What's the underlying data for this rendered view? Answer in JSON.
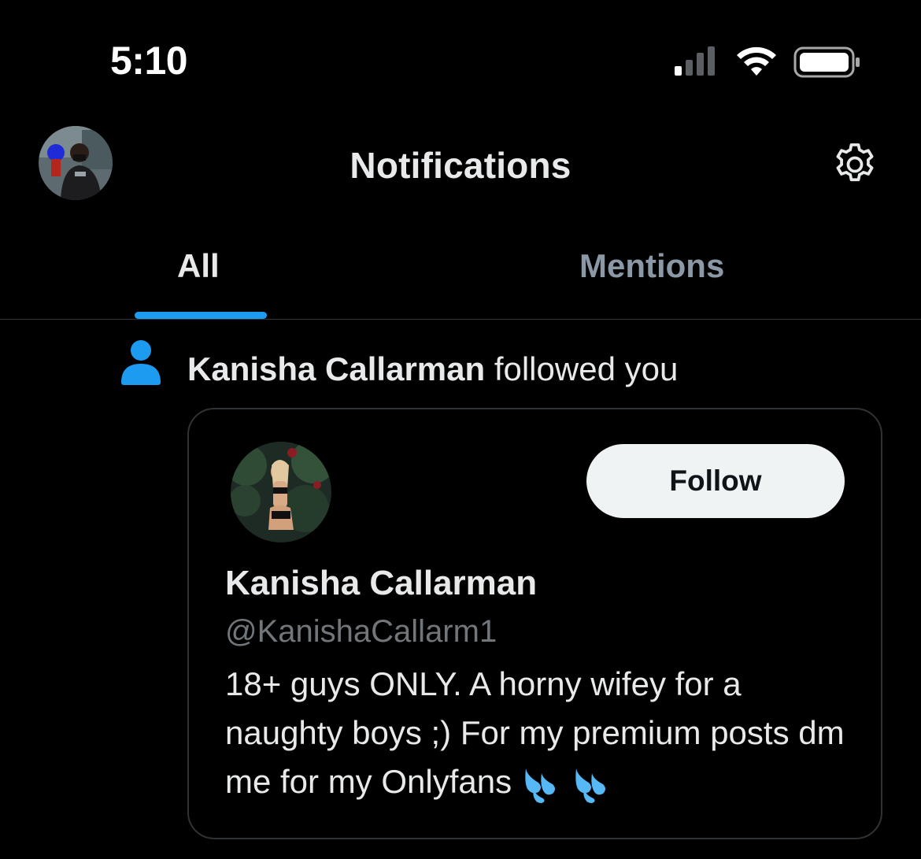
{
  "status_bar": {
    "time": "5:10",
    "signal_icon": "cellular-signal-icon",
    "wifi_icon": "wifi-icon",
    "battery_icon": "battery-icon"
  },
  "header": {
    "title": "Notifications",
    "avatar_icon": "profile-avatar",
    "settings_icon": "gear-icon"
  },
  "tabs": [
    {
      "label": "All",
      "active": true
    },
    {
      "label": "Mentions",
      "active": false
    }
  ],
  "notification": {
    "icon": "person-icon",
    "actor_name": "Kanisha Callarman",
    "action_text": " followed you",
    "card": {
      "name": "Kanisha Callarman",
      "handle": "@KanishaCallarm1",
      "bio": "18+ guys ONLY. A horny wifey for a naughty boys ;) For my premium posts dm me for my Onlyfans",
      "bio_emoji": "sweat-droplets-emoji",
      "follow_label": "Follow"
    }
  },
  "colors": {
    "background": "#000000",
    "accent": "#1d9bf0",
    "text_primary": "#e7e9ea",
    "text_secondary": "#71767b",
    "follow_button_bg": "#eff3f4"
  }
}
